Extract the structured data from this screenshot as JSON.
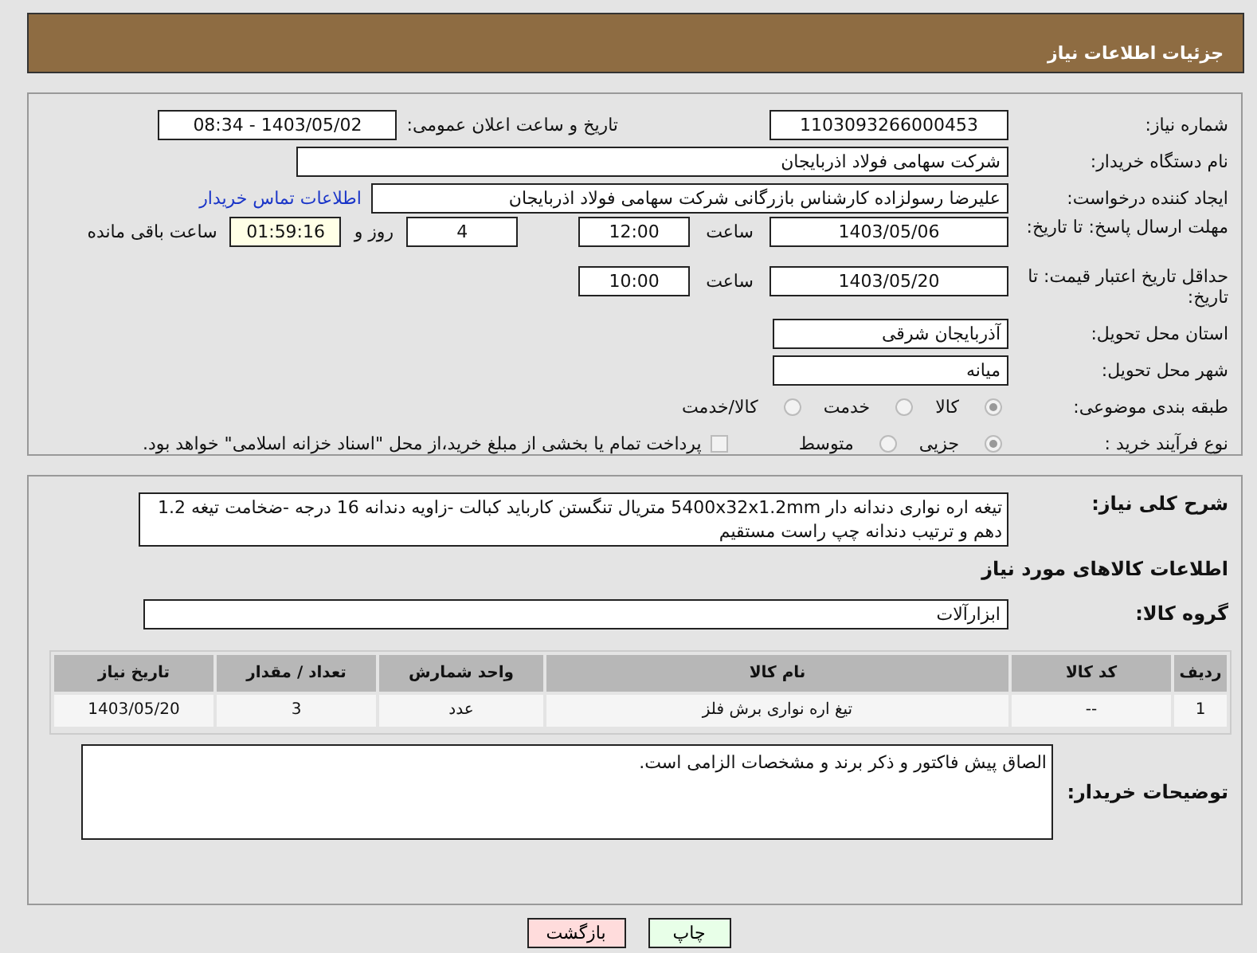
{
  "header": {
    "title": "جزئیات اطلاعات نیاز"
  },
  "need_number": {
    "label": "شماره نیاز:",
    "value": "1103093266000453"
  },
  "announce": {
    "label": "تاریخ و ساعت اعلان عمومی:",
    "value": "1403/05/02 - 08:34"
  },
  "buyer_org": {
    "label": "نام دستگاه خریدار:",
    "value": "شرکت سهامی فولاد اذربایجان"
  },
  "requester": {
    "label": "ایجاد کننده درخواست:",
    "value": "علیرضا رسولزاده کارشناس بازرگانی شرکت سهامی فولاد اذربایجان",
    "link": "اطلاعات تماس خریدار"
  },
  "reply_deadline": {
    "label": "مهلت ارسال پاسخ: تا تاریخ:",
    "date": "1403/05/06",
    "time_label": "ساعت",
    "time": "12:00",
    "days": "4",
    "days_label": "روز و",
    "remaining": "01:59:16",
    "remaining_label": "ساعت باقی مانده"
  },
  "price_validity": {
    "label": "حداقل تاریخ اعتبار قیمت: تا تاریخ:",
    "date": "1403/05/20",
    "time_label": "ساعت",
    "time": "10:00"
  },
  "province": {
    "label": "استان محل تحویل:",
    "value": "آذربایجان شرقی"
  },
  "city": {
    "label": "شهر محل تحویل:",
    "value": "میانه"
  },
  "category": {
    "label": "طبقه بندی موضوعی:",
    "options": [
      {
        "label": "کالا",
        "selected": true
      },
      {
        "label": "خدمت",
        "selected": false
      },
      {
        "label": "کالا/خدمت",
        "selected": false
      }
    ]
  },
  "purchase_process": {
    "label": "نوع فرآیند خرید :",
    "options": [
      {
        "label": "جزیی",
        "selected": true
      },
      {
        "label": "متوسط",
        "selected": false
      }
    ],
    "payment_note": {
      "checked": false,
      "text": "پرداخت تمام یا بخشی از مبلغ خرید،از محل \"اسناد خزانه اسلامی\" خواهد بود."
    }
  },
  "description": {
    "label": "شرح کلی نیاز:",
    "value": "تیغه اره نواری دندانه دار 5400x32x1.2mm   متریال تنگستن کارباید کبالت -زاویه دندانه 16 درجه -ضخامت تیغه 1.2 دهم و ترتیب دندانه چپ راست مستقیم"
  },
  "goods_heading": "اطلاعات کالاهای مورد نیاز",
  "goods_group": {
    "label": "گروه کالا:",
    "value": "ابزارآلات"
  },
  "table": {
    "columns": [
      "ردیف",
      "کد کالا",
      "نام کالا",
      "واحد شمارش",
      "تعداد / مقدار",
      "تاریخ نیاز"
    ],
    "rows": [
      [
        "1",
        "--",
        "تیغ اره نواری برش فلز",
        "عدد",
        "3",
        "1403/05/20"
      ]
    ]
  },
  "buyer_notes": {
    "label": "توضیحات خریدار:",
    "value": "الصاق پیش فاکتور و ذکر برند و مشخصات الزامی است."
  },
  "buttons": [
    {
      "label": "چاپ",
      "kind": "print"
    },
    {
      "label": "بازگشت",
      "kind": "back"
    }
  ]
}
